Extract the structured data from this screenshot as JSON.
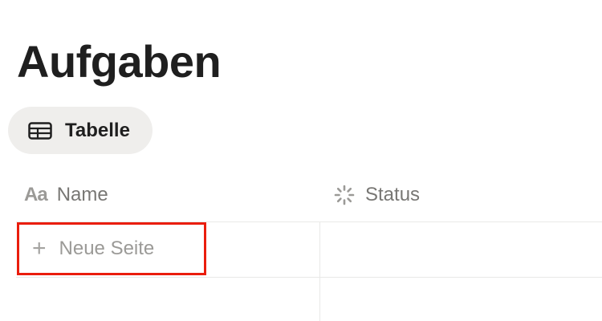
{
  "page": {
    "title": "Aufgaben"
  },
  "views": [
    {
      "label": "Tabelle",
      "icon": "table-icon"
    }
  ],
  "table": {
    "columns": [
      {
        "label": "Name",
        "icon": "text-type-icon",
        "icon_text": "Aa"
      },
      {
        "label": "Status",
        "icon": "status-spinner-icon"
      }
    ],
    "new_row_label": "Neue Seite",
    "new_row_icon": "plus-icon"
  },
  "colors": {
    "highlight_border": "#ea1d0d",
    "tab_background": "#efeeec",
    "muted_text": "#787774"
  }
}
